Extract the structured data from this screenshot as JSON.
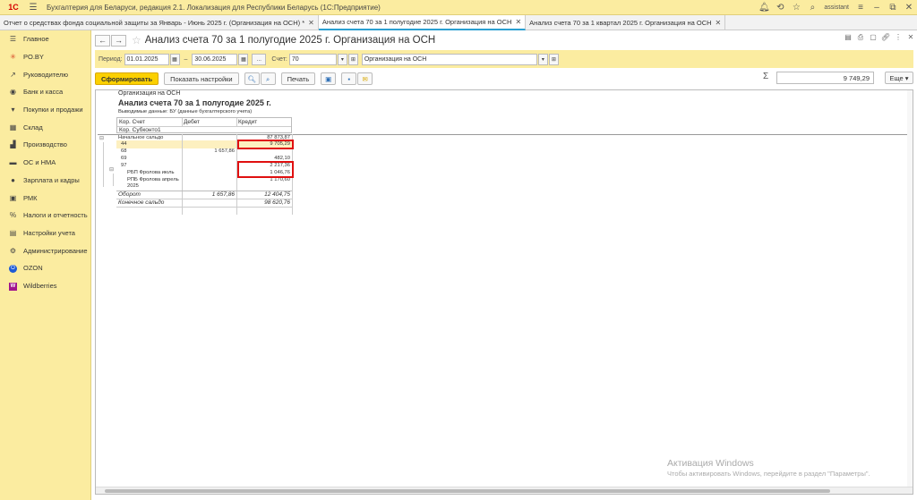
{
  "app": {
    "logo": "1С",
    "title": "Бухгалтерия для Беларуси, редакция 2.1. Локализация для Республики Беларусь (1С:Предприятие)",
    "user": "assistant"
  },
  "tabs": [
    {
      "label": "Отчет о средствах фонда социальной защиты за Январь - Июнь 2025 г. (Организация на ОСН) *",
      "active": false
    },
    {
      "label": "Анализ счета 70 за 1 полугодие 2025 г. Организация на ОСН",
      "active": true
    },
    {
      "label": "Анализ счета 70 за 1 квартал 2025 г. Организация на ОСН",
      "active": false
    }
  ],
  "sidebar": {
    "items": [
      {
        "label": "Главное",
        "icon": "menu-icon"
      },
      {
        "label": "PO.BY",
        "icon": "sun-icon"
      },
      {
        "label": "Руководителю",
        "icon": "trend-icon"
      },
      {
        "label": "Банк и касса",
        "icon": "bank-icon"
      },
      {
        "label": "Покупки и продажи",
        "icon": "cart-icon"
      },
      {
        "label": "Склад",
        "icon": "warehouse-icon"
      },
      {
        "label": "Производство",
        "icon": "factory-icon"
      },
      {
        "label": "ОС и НМА",
        "icon": "truck-icon"
      },
      {
        "label": "Зарплата и кадры",
        "icon": "person-icon"
      },
      {
        "label": "РМК",
        "icon": "register-icon"
      },
      {
        "label": "Налоги и отчетность",
        "icon": "tax-icon"
      },
      {
        "label": "Настройки учета",
        "icon": "settings-icon"
      },
      {
        "label": "Администрирование",
        "icon": "gear-icon"
      },
      {
        "label": "OZON",
        "icon": "ozon-icon"
      },
      {
        "label": "Wildberries",
        "icon": "wildberries-icon"
      }
    ]
  },
  "form": {
    "title": "Анализ счета 70 за 1 полугодие 2025 г. Организация на ОСН"
  },
  "params": {
    "period_label": "Период:",
    "date_from": "01.01.2025",
    "dash": "–",
    "date_to": "30.06.2025",
    "dots": "...",
    "account_label": "Счет:",
    "account": "70",
    "organization": "Организация на ОСН"
  },
  "actions": {
    "generate": "Сформировать",
    "show_settings": "Показать настройки",
    "print": "Печать",
    "sum_value": "9 749,29",
    "more": "Еще"
  },
  "report": {
    "org": "Организация на ОСН",
    "title": "Анализ счета 70 за 1 полугодие 2025 г.",
    "meta": "Выводимые данные:  БУ (данные бухгалтерского учета)",
    "headers": {
      "kor_schet": "Кор. Счет",
      "kor_subkonto": "Кор. Субконто1",
      "debit": "Дебет",
      "credit": "Кредит"
    },
    "rows": [
      {
        "label": "Начальное сальдо",
        "debit": "",
        "credit": "87 873,87"
      },
      {
        "label": "44",
        "debit": "",
        "credit": "9 705,29"
      },
      {
        "label": "68",
        "debit": "1 657,86",
        "credit": ""
      },
      {
        "label": "69",
        "debit": "",
        "credit": "482,10"
      },
      {
        "label": "97",
        "debit": "",
        "credit": "2 217,36"
      },
      {
        "label": "РБП Фролова июль",
        "debit": "",
        "credit": "1 046,76"
      },
      {
        "label": "РПБ Фролова апрель",
        "debit": "",
        "credit": "1 170,60"
      },
      {
        "label": "2025",
        "debit": "",
        "credit": ""
      }
    ],
    "turnover": {
      "label": "Оборот",
      "debit": "1 657,86",
      "credit": "12 404,75"
    },
    "closing": {
      "label": "Конечное сальдо",
      "debit": "",
      "credit": "98 620,76"
    }
  },
  "watermark": {
    "line1": "Активация Windows",
    "line2": "Чтобы активировать Windows, перейдите в раздел \"Параметры\"."
  },
  "colors": {
    "sidebar_bg": "#fbeca0",
    "primary_button": "#fbd000",
    "highlight_box": "#e01010",
    "active_tab_accent": "#2aa0d2"
  }
}
